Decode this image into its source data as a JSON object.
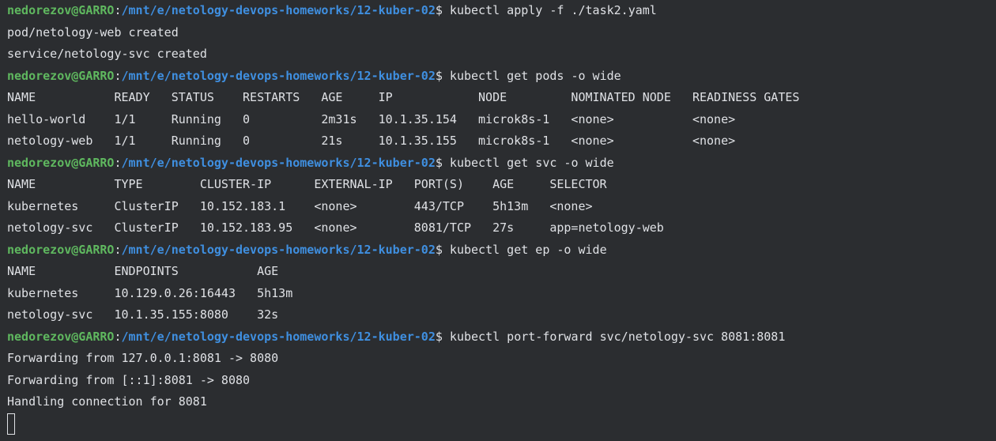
{
  "prompt": {
    "user_host": "nedorezov@GARRO",
    "separator": ":",
    "path": "/mnt/e/netology-devops-homeworks/12-kuber-02",
    "symbol": "$"
  },
  "commands": [
    " kubectl apply -f ./task2.yaml",
    " kubectl get pods -o wide",
    " kubectl get svc -o wide",
    " kubectl get ep -o wide",
    " kubectl port-forward svc/netology-svc 8081:8081"
  ],
  "apply_output": [
    "pod/netology-web created",
    "service/netology-svc created"
  ],
  "pods_table": [
    "NAME           READY   STATUS    RESTARTS   AGE     IP            NODE         NOMINATED NODE   READINESS GATES",
    "hello-world    1/1     Running   0          2m31s   10.1.35.154   microk8s-1   <none>           <none>",
    "netology-web   1/1     Running   0          21s     10.1.35.155   microk8s-1   <none>           <none>"
  ],
  "svc_table": [
    "NAME           TYPE        CLUSTER-IP      EXTERNAL-IP   PORT(S)    AGE     SELECTOR",
    "kubernetes     ClusterIP   10.152.183.1    <none>        443/TCP    5h13m   <none>",
    "netology-svc   ClusterIP   10.152.183.95   <none>        8081/TCP   27s     app=netology-web"
  ],
  "ep_table": [
    "NAME           ENDPOINTS           AGE",
    "kubernetes     10.129.0.26:16443   5h13m",
    "netology-svc   10.1.35.155:8080    32s"
  ],
  "forward_output": [
    "Forwarding from 127.0.0.1:8081 -> 8080",
    "Forwarding from [::1]:8081 -> 8080",
    "Handling connection for 8081"
  ]
}
